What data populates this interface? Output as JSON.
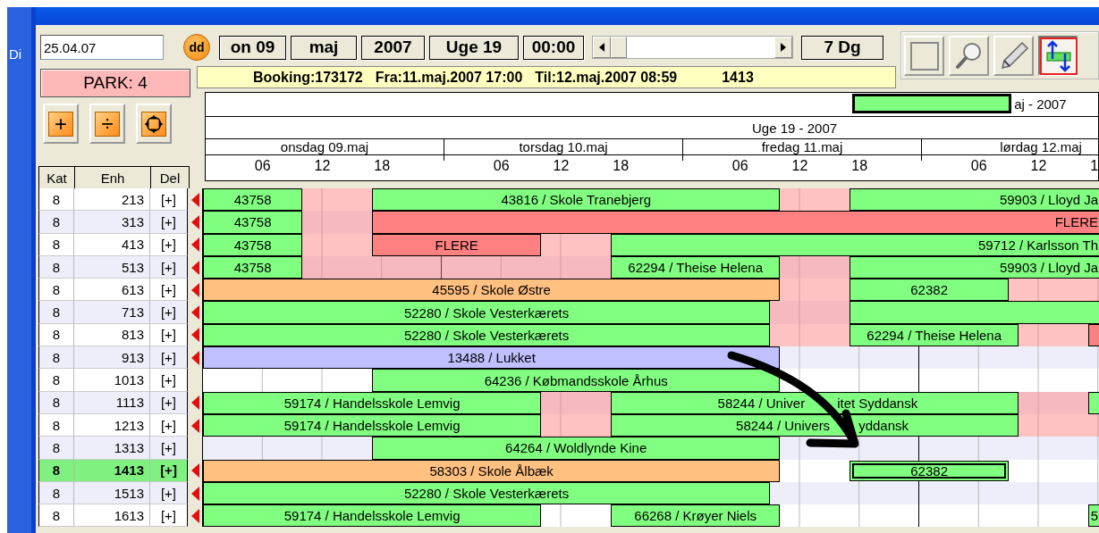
{
  "desktop": {
    "label": "Di"
  },
  "date_field": {
    "value": "25.04.07"
  },
  "today_button": {
    "label": "dd"
  },
  "period": {
    "day": "on 09",
    "month": "maj",
    "year": "2007",
    "week": "Uge 19",
    "time": "00:00",
    "range": "7 Dg"
  },
  "tools": [
    {
      "selected": false
    },
    {
      "selected": false
    },
    {
      "selected": false
    },
    {
      "selected": true
    }
  ],
  "park": {
    "label": "PARK: 4"
  },
  "info": [
    "Booking:173172",
    "Fra:11.maj.2007 17:00",
    "Til:12.maj.2007 08:59",
    "1413"
  ],
  "actions": [
    {
      "kind": "text",
      "label": "+"
    },
    {
      "kind": "text",
      "label": "÷"
    },
    {
      "kind": "icon"
    }
  ],
  "timeline": {
    "month_label": "aj - 2007",
    "week_label": "Uge 19 - 2007",
    "days": [
      {
        "label": "onsdag 09.maj",
        "hours": [
          "06",
          "12",
          "18"
        ]
      },
      {
        "label": "torsdag 10.maj",
        "hours": [
          "06",
          "12",
          "18"
        ]
      },
      {
        "label": "fredag 11.maj",
        "hours": [
          "06",
          "12",
          "18"
        ]
      },
      {
        "label": "lørdag 12.maj",
        "hours": [
          "06",
          "12",
          "1"
        ]
      }
    ]
  },
  "columns": [
    "Kat",
    "Enh",
    "Del"
  ],
  "units": [
    {
      "kat": "8",
      "enh": "213",
      "del": "[+]",
      "flagged": true,
      "selected": false,
      "segments": [
        {
          "kind": "booking",
          "label": "43758",
          "color": "#80ff80",
          "selected": false
        },
        {
          "kind": "blocked"
        },
        {
          "kind": "booking",
          "label": "43816 / Skole Tranebjerg",
          "color": "#80ff80",
          "selected": false
        },
        {
          "kind": "blocked"
        },
        {
          "kind": "booking",
          "label": "59903 / Lloyd Ja",
          "color": "#80ff80",
          "selected": false
        }
      ]
    },
    {
      "kat": "8",
      "enh": "313",
      "del": "[+]",
      "flagged": true,
      "selected": false,
      "segments": [
        {
          "kind": "booking",
          "label": "43758",
          "color": "#80ff80",
          "selected": false
        },
        {
          "kind": "blocked"
        },
        {
          "kind": "booking",
          "label": "FLERE",
          "color": "#ff8080",
          "selected": false
        }
      ]
    },
    {
      "kat": "8",
      "enh": "413",
      "del": "[+]",
      "flagged": true,
      "selected": false,
      "segments": [
        {
          "kind": "booking",
          "label": "43758",
          "color": "#80ff80",
          "selected": false
        },
        {
          "kind": "blocked"
        },
        {
          "kind": "booking",
          "label": "FLERE",
          "color": "#ff8080",
          "selected": false
        },
        {
          "kind": "blocked"
        },
        {
          "kind": "booking",
          "label": "59712 / Karlsson Th",
          "color": "#80ff80",
          "selected": false
        }
      ]
    },
    {
      "kat": "8",
      "enh": "513",
      "del": "[+]",
      "flagged": true,
      "selected": false,
      "segments": [
        {
          "kind": "booking",
          "label": "43758",
          "color": "#80ff80",
          "selected": false
        },
        {
          "kind": "blocked"
        },
        {
          "kind": "booking",
          "label": "62294 / Theise Helena",
          "color": "#80ff80",
          "selected": false
        },
        {
          "kind": "blocked"
        },
        {
          "kind": "booking",
          "label": "59903 / Lloyd Ja",
          "color": "#80ff80",
          "selected": false
        }
      ]
    },
    {
      "kat": "8",
      "enh": "613",
      "del": "[+]",
      "flagged": true,
      "selected": false,
      "segments": [
        {
          "kind": "booking",
          "label": "45595 / Skole Østre",
          "color": "#ffc080",
          "selected": false
        },
        {
          "kind": "blocked"
        },
        {
          "kind": "booking",
          "label": "62382",
          "color": "#80ff80",
          "selected": false
        },
        {
          "kind": "blocked"
        }
      ]
    },
    {
      "kat": "8",
      "enh": "713",
      "del": "[+]",
      "flagged": true,
      "selected": false,
      "segments": [
        {
          "kind": "booking",
          "label": "52280 / Skole Vesterkærets",
          "color": "#80ff80",
          "selected": false
        },
        {
          "kind": "blocked"
        },
        {
          "kind": "booking",
          "color": "#80ff80",
          "selected": false
        }
      ]
    },
    {
      "kat": "8",
      "enh": "813",
      "del": "[+]",
      "flagged": true,
      "selected": false,
      "segments": [
        {
          "kind": "booking",
          "label": "52280 / Skole Vesterkærets",
          "color": "#80ff80",
          "selected": false
        },
        {
          "kind": "blocked"
        },
        {
          "kind": "booking",
          "label": "62294 / Theise Helena",
          "color": "#80ff80",
          "selected": false
        },
        {
          "kind": "blocked"
        },
        {
          "kind": "booking",
          "color": "#ff8080",
          "selected": false
        }
      ]
    },
    {
      "kat": "8",
      "enh": "913",
      "del": "[+]",
      "flagged": true,
      "selected": false,
      "segments": [
        {
          "kind": "booking",
          "label": "13488 / Lukket",
          "color": "#c0c0ff",
          "selected": false
        }
      ]
    },
    {
      "kat": "8",
      "enh": "1013",
      "del": "[+]",
      "flagged": false,
      "selected": false,
      "segments": [
        {
          "kind": "booking",
          "label": "64236 / Købmandsskole Århus",
          "color": "#80ff80",
          "selected": false
        }
      ]
    },
    {
      "kat": "8",
      "enh": "1113",
      "del": "[+]",
      "flagged": true,
      "selected": false,
      "segments": [
        {
          "kind": "booking",
          "label": "59174 / Handelsskole Lemvig",
          "color": "#80ff80",
          "selected": false
        },
        {
          "kind": "blocked"
        },
        {
          "kind": "booking",
          "label_parts": [
            "58244 / Univer",
            "itet Syddansk"
          ],
          "color": "#80ff80",
          "selected": false
        },
        {
          "kind": "blocked"
        },
        {
          "kind": "booking",
          "color": "#80ff80",
          "selected": false
        }
      ]
    },
    {
      "kat": "8",
      "enh": "1213",
      "del": "[+]",
      "flagged": true,
      "selected": false,
      "segments": [
        {
          "kind": "booking",
          "label": "59174 / Handelsskole Lemvig",
          "color": "#80ff80",
          "selected": false
        },
        {
          "kind": "blocked"
        },
        {
          "kind": "booking",
          "label_parts": [
            "58244 / Univers",
            "yddansk"
          ],
          "color": "#80ff80",
          "selected": false
        },
        {
          "kind": "blocked"
        }
      ]
    },
    {
      "kat": "8",
      "enh": "1313",
      "del": "[+]",
      "flagged": false,
      "selected": false,
      "segments": [
        {
          "kind": "booking",
          "label": "64264 / Woldlynde Kine",
          "color": "#80ff80",
          "selected": false
        }
      ]
    },
    {
      "kat": "8",
      "enh": "1413",
      "del": "[+]",
      "flagged": true,
      "selected": true,
      "segments": [
        {
          "kind": "booking",
          "label": "58303 / Skole Ålbæk",
          "color": "#ffc080",
          "selected": false
        },
        {
          "kind": "booking",
          "label": "62382",
          "color": "#80ff80",
          "selected": true
        }
      ]
    },
    {
      "kat": "8",
      "enh": "1513",
      "del": "[+]",
      "flagged": true,
      "selected": false,
      "segments": [
        {
          "kind": "booking",
          "label": "52280 / Skole Vesterkærets",
          "color": "#80ff80",
          "selected": false
        }
      ]
    },
    {
      "kat": "8",
      "enh": "1613",
      "del": "[+]",
      "flagged": true,
      "selected": false,
      "segments": [
        {
          "kind": "booking",
          "label": "59174 / Handelsskole Lemvig",
          "color": "#80ff80",
          "selected": false
        },
        {
          "kind": "booking",
          "label": "66268 / Krøyer Niels",
          "color": "#80ff80",
          "selected": false
        },
        {
          "kind": "booking",
          "label": "5",
          "color": "#80ff80",
          "selected": false
        }
      ]
    }
  ]
}
